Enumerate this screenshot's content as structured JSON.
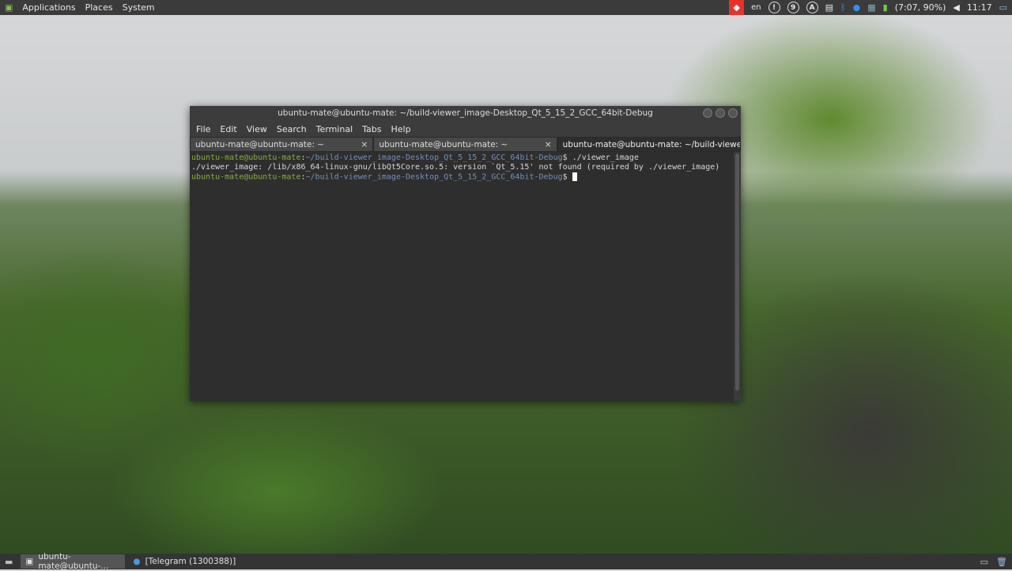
{
  "top_panel": {
    "menus": [
      "Applications",
      "Places",
      "System"
    ],
    "keyboard": "en",
    "indicators": [
      "!",
      "9",
      "A"
    ],
    "battery": "(7:07, 90%)",
    "clock": "11:17"
  },
  "window": {
    "title": "ubuntu-mate@ubuntu-mate: ~/build-viewer_image-Desktop_Qt_5_15_2_GCC_64bit-Debug",
    "menu": [
      "File",
      "Edit",
      "View",
      "Search",
      "Terminal",
      "Tabs",
      "Help"
    ],
    "tabs": [
      {
        "label": "ubuntu-mate@ubuntu-mate: ~"
      },
      {
        "label": "ubuntu-mate@ubuntu-mate: ~"
      },
      {
        "label": "ubuntu-mate@ubuntu-mate: ~/build-viewer..."
      }
    ],
    "close_glyph": "×",
    "lines": [
      {
        "user": "ubuntu-mate@ubuntu-mate",
        "sep": ":",
        "path": "~/build-viewer_image-Desktop_Qt_5_15_2_GCC_64bit-Debug",
        "cmd": "$ ./viewer_image"
      },
      {
        "text": "./viewer_image: /lib/x86_64-linux-gnu/libQt5Core.so.5: version `Qt_5.15' not found (required by ./viewer_image)"
      },
      {
        "user": "ubuntu-mate@ubuntu-mate",
        "sep": ":",
        "path": "~/build-viewer_image-Desktop_Qt_5_15_2_GCC_64bit-Debug",
        "cmd": "$ "
      }
    ]
  },
  "taskbar": {
    "items": [
      "ubuntu-mate@ubuntu-...",
      "[Telegram (1300388)]"
    ]
  }
}
